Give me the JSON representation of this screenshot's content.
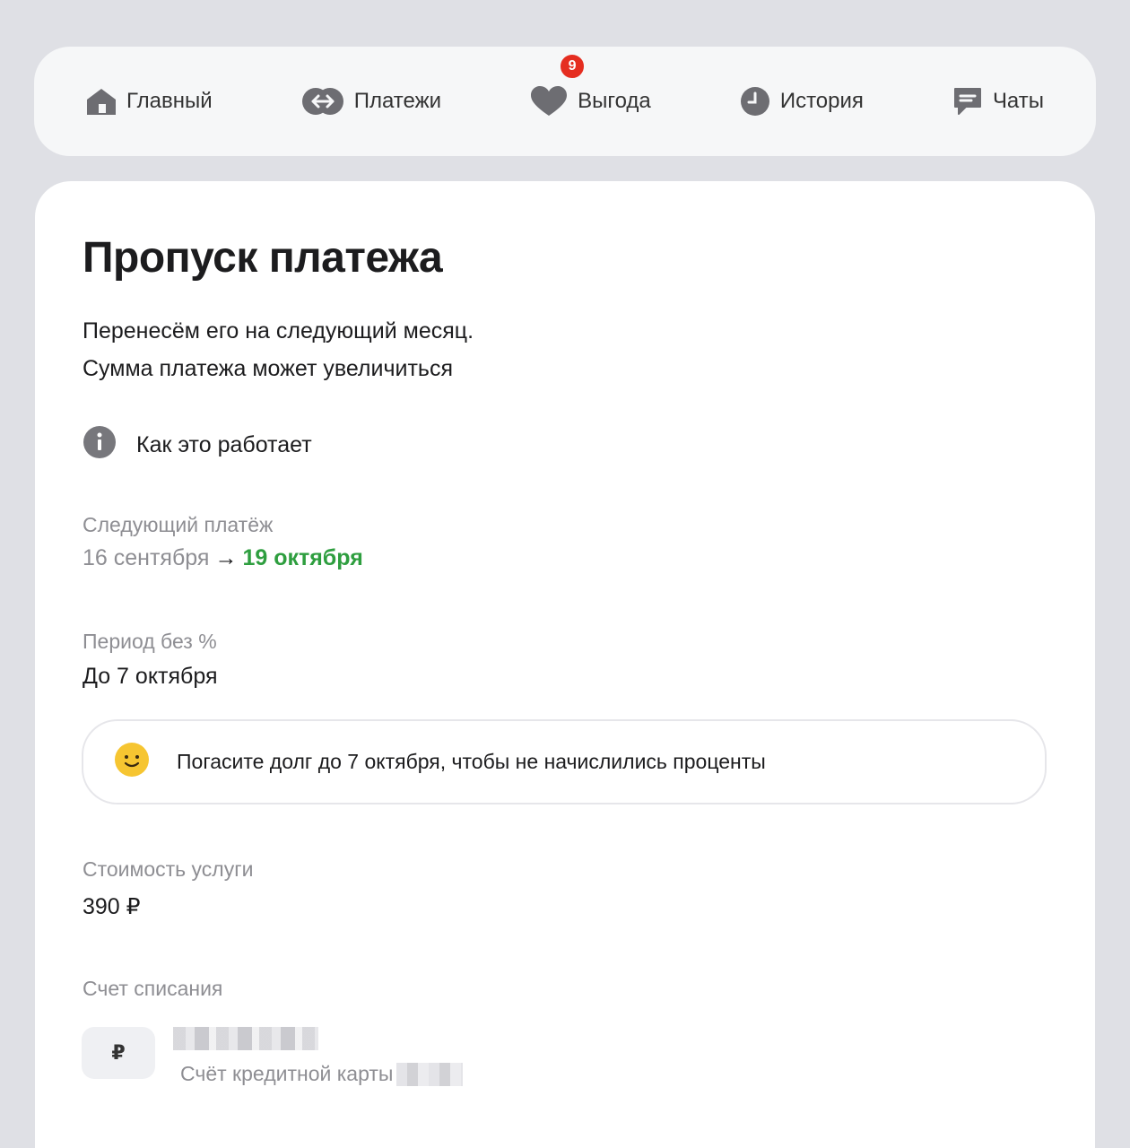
{
  "nav": {
    "items": [
      {
        "label": "Главный",
        "icon": "home-icon"
      },
      {
        "label": "Платежи",
        "icon": "transfer-icon"
      },
      {
        "label": "Выгода",
        "icon": "heart-icon",
        "badge": "9"
      },
      {
        "label": "История",
        "icon": "clock-icon"
      },
      {
        "label": "Чаты",
        "icon": "chat-icon"
      }
    ]
  },
  "page": {
    "title": "Пропуск платежа",
    "subtitle_line1": "Перенесём его на следующий месяц.",
    "subtitle_line2": "Сумма платежа может увеличиться",
    "how_it_works": "Как это работает",
    "next_payment": {
      "label": "Следующий платёж",
      "old_date": "16 сентября",
      "arrow": "→",
      "new_date": "19 октября"
    },
    "grace_period": {
      "label": "Период без %",
      "value": "До 7 октября"
    },
    "notice": "Погасите долг до 7 октября, чтобы не начислились проценты",
    "cost": {
      "label": "Стоимость услуги",
      "value": "390 ₽"
    },
    "account": {
      "label": "Счет списания",
      "currency_symbol": "₽",
      "description": "Счёт кредитной карты"
    }
  },
  "colors": {
    "background": "#dfe0e5",
    "accent_green": "#2e9e3f",
    "badge_red": "#e52d20",
    "muted_text": "#8e8e93"
  }
}
